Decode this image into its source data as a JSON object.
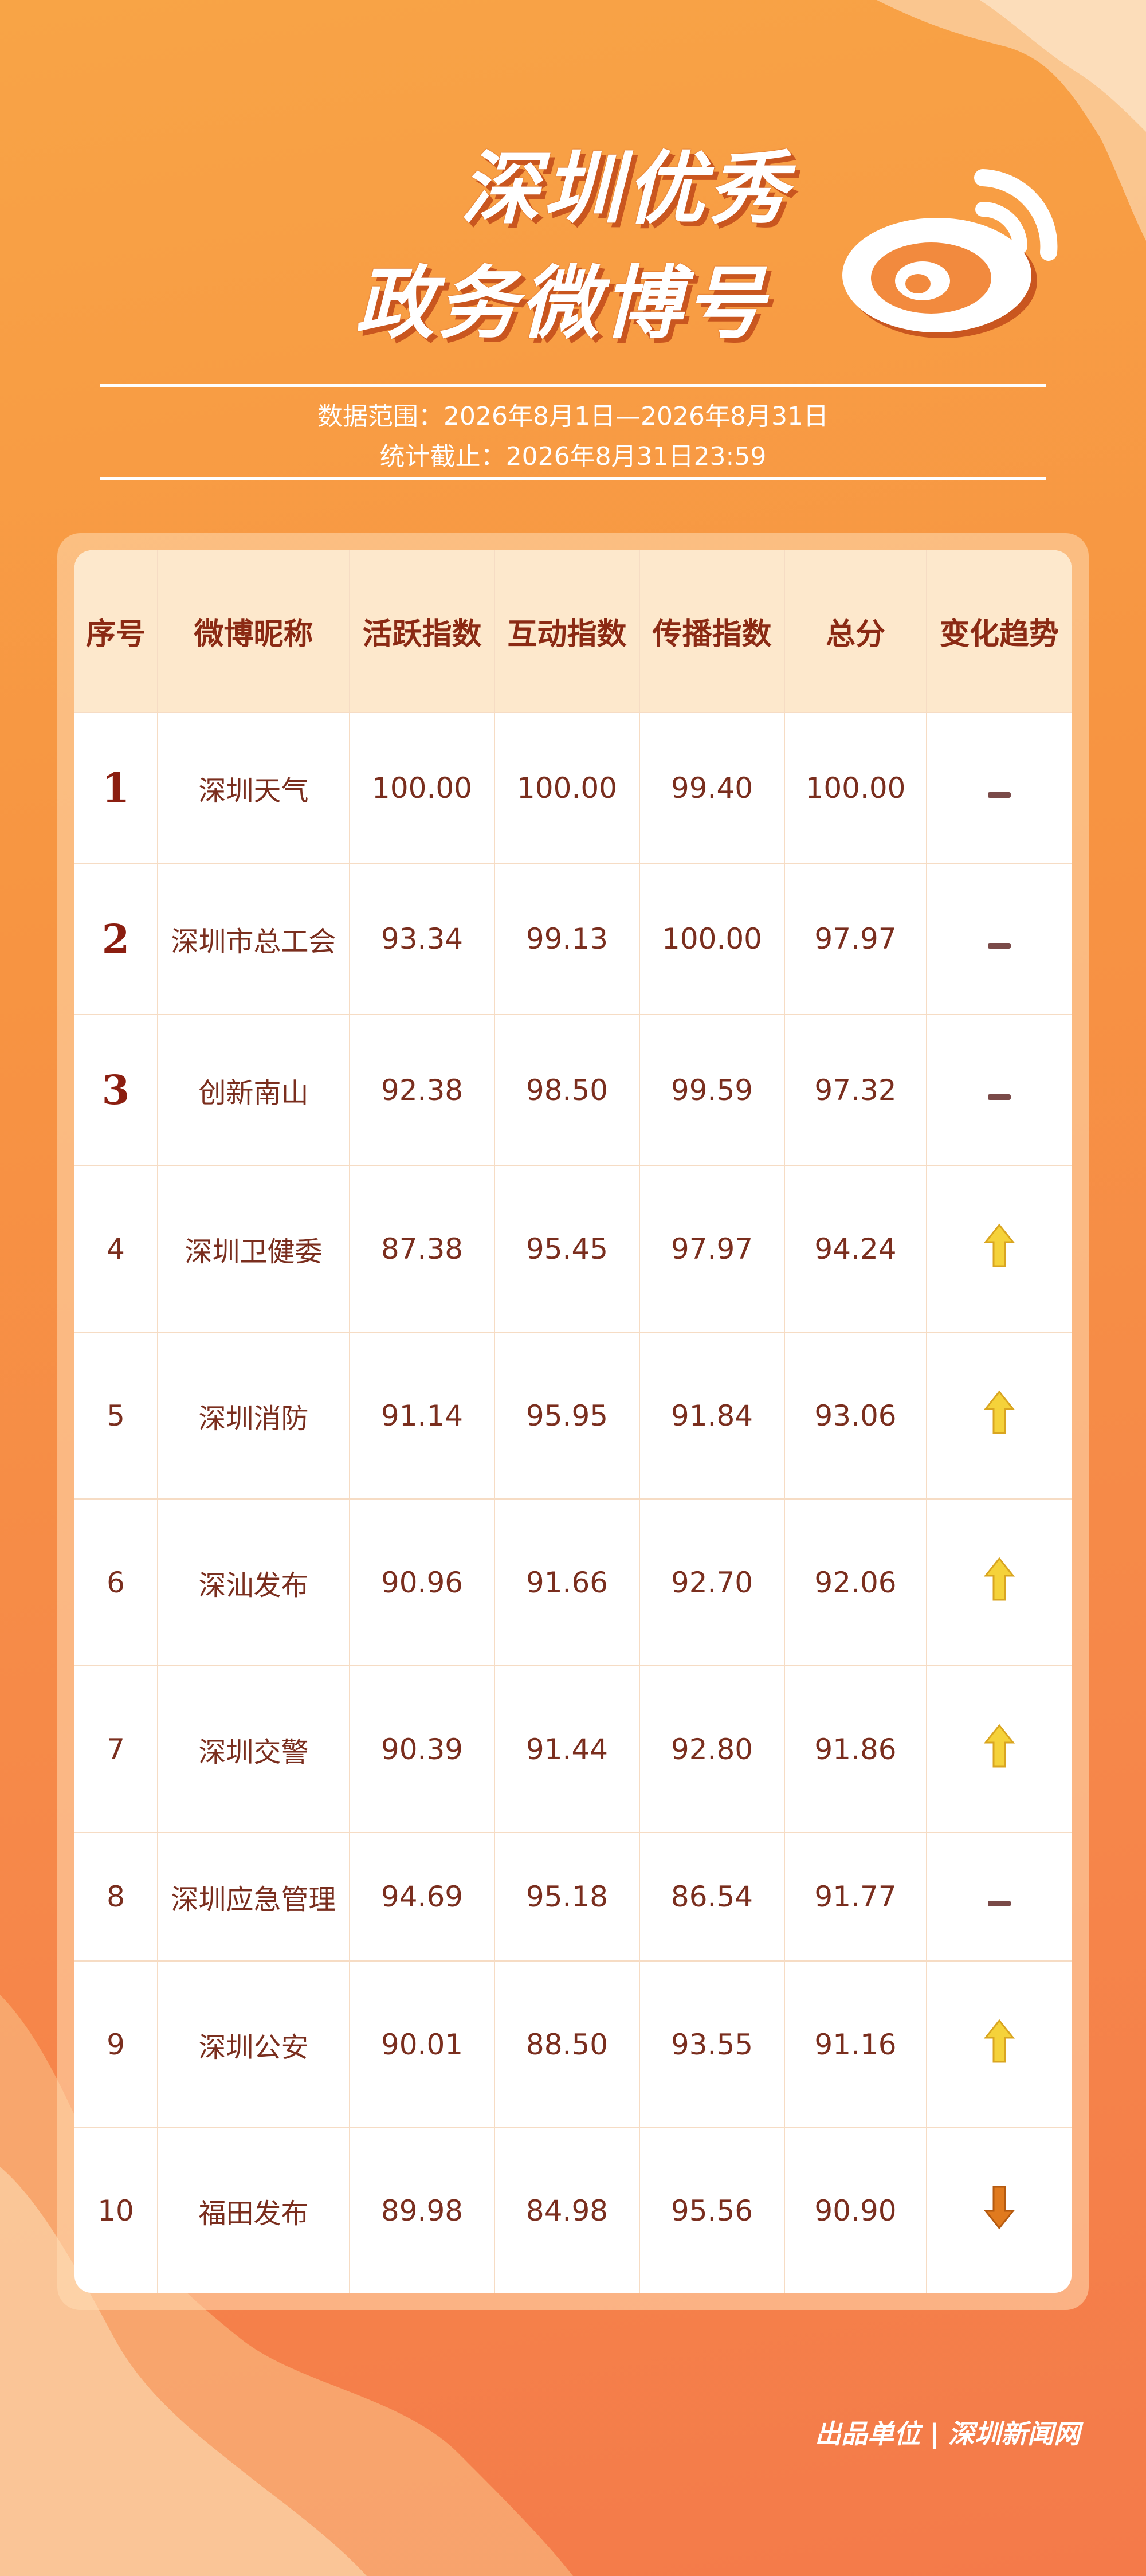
{
  "title": {
    "line1": "深圳优秀",
    "line2": "政务微博号"
  },
  "meta": {
    "range": "数据范围：2026年8月1日—2026年8月31日",
    "cutoff": "统计截止：2026年8月31日23:59"
  },
  "table": {
    "headers": [
      "序号",
      "微博昵称",
      "活跃指数",
      "互动指数",
      "传播指数",
      "总分",
      "变化趋势"
    ],
    "rows": [
      {
        "rank": "1",
        "name": "深圳天气",
        "active": "100.00",
        "interact": "100.00",
        "spread": "99.40",
        "total": "100.00",
        "trend": "flat"
      },
      {
        "rank": "2",
        "name": "深圳市总工会",
        "active": "93.34",
        "interact": "99.13",
        "spread": "100.00",
        "total": "97.97",
        "trend": "flat"
      },
      {
        "rank": "3",
        "name": "创新南山",
        "active": "92.38",
        "interact": "98.50",
        "spread": "99.59",
        "total": "97.32",
        "trend": "flat"
      },
      {
        "rank": "4",
        "name": "深圳卫健委",
        "active": "87.38",
        "interact": "95.45",
        "spread": "97.97",
        "total": "94.24",
        "trend": "up"
      },
      {
        "rank": "5",
        "name": "深圳消防",
        "active": "91.14",
        "interact": "95.95",
        "spread": "91.84",
        "total": "93.06",
        "trend": "up"
      },
      {
        "rank": "6",
        "name": "深汕发布",
        "active": "90.96",
        "interact": "91.66",
        "spread": "92.70",
        "total": "92.06",
        "trend": "up"
      },
      {
        "rank": "7",
        "name": "深圳交警",
        "active": "90.39",
        "interact": "91.44",
        "spread": "92.80",
        "total": "91.86",
        "trend": "up"
      },
      {
        "rank": "8",
        "name": "深圳应急管理",
        "active": "94.69",
        "interact": "95.18",
        "spread": "86.54",
        "total": "91.77",
        "trend": "flat"
      },
      {
        "rank": "9",
        "name": "深圳公安",
        "active": "90.01",
        "interact": "88.50",
        "spread": "93.55",
        "total": "91.16",
        "trend": "up"
      },
      {
        "rank": "10",
        "name": "福田发布",
        "active": "89.98",
        "interact": "84.98",
        "spread": "95.56",
        "total": "90.90",
        "trend": "down"
      }
    ]
  },
  "icons": {
    "logo": "weibo-logo-icon",
    "up": "arrow-up-icon",
    "down": "arrow-down-icon",
    "flat": "dash-icon"
  },
  "colors": {
    "accent": "#f79442",
    "header_bg": "#fde8cc",
    "text": "#7a2e1e",
    "up_arrow": "#f5d23a",
    "down_arrow": "#e07a1e"
  },
  "footer": {
    "text": "出品单位 | 深圳新闻网"
  }
}
